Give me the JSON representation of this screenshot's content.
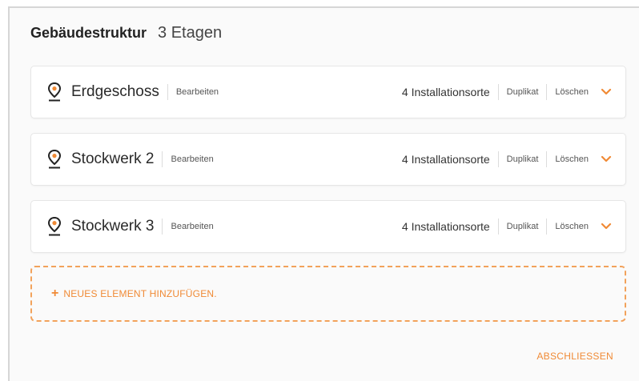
{
  "header": {
    "title": "Gebäudestruktur",
    "count": "3 Etagen"
  },
  "floors": [
    {
      "name": "Erdgeschoss",
      "edit_label": "Bearbeiten",
      "installations": "4 Installationsorte",
      "duplicate_label": "Duplikat",
      "delete_label": "Löschen"
    },
    {
      "name": "Stockwerk 2",
      "edit_label": "Bearbeiten",
      "installations": "4 Installationsorte",
      "duplicate_label": "Duplikat",
      "delete_label": "Löschen"
    },
    {
      "name": "Stockwerk 3",
      "edit_label": "Bearbeiten",
      "installations": "4 Installationsorte",
      "duplicate_label": "Duplikat",
      "delete_label": "Löschen"
    }
  ],
  "add_element": {
    "plus": "+",
    "label": "NEUES ELEMENT HINZUFÜGEN."
  },
  "finish_label": "ABSCHLIESSEN",
  "icons": {
    "floor": "map-pin-icon",
    "expand": "chevron-down-icon"
  },
  "colors": {
    "accent": "#f08a35",
    "text": "#2b2b2b"
  }
}
